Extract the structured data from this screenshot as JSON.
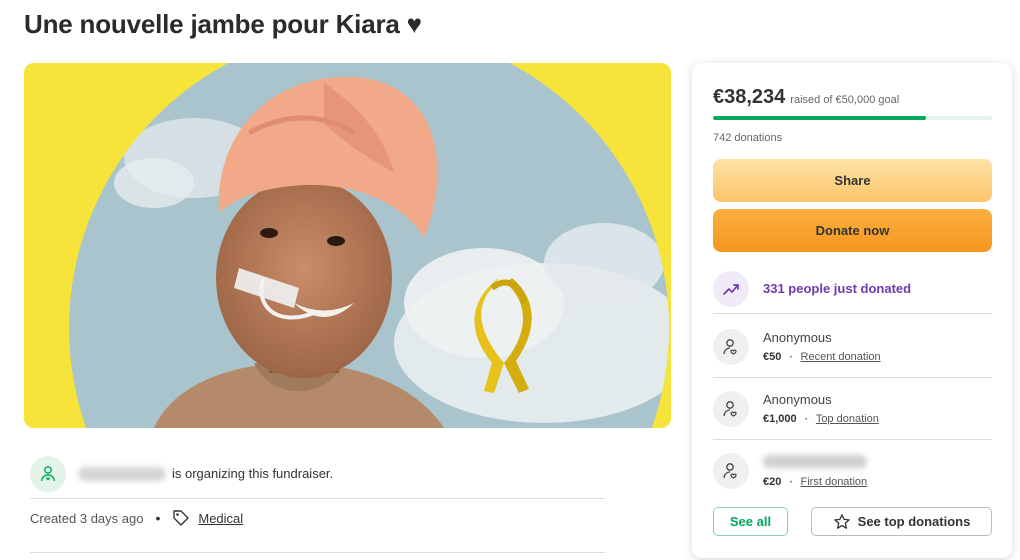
{
  "page": {
    "title": "Une nouvelle jambe pour Kiara ♥"
  },
  "hero": {
    "image_alt": "campaign-photo"
  },
  "organizer": {
    "text": "is organizing this fundraiser.",
    "icon": "person-heart-icon"
  },
  "meta": {
    "created": "Created 3 days ago",
    "separator": "•",
    "category": "Medical",
    "icon": "tag-icon"
  },
  "donation_card": {
    "raised_amount": "€38,234",
    "goal_text": "raised of €50,000 goal",
    "progress_fraction": 0.765,
    "donation_count": "742 donations",
    "share_label": "Share",
    "donate_label": "Donate now",
    "trend_text": "331 people just donated",
    "trend_icon": "trending-up-icon",
    "donors": [
      {
        "name": "Anonymous",
        "amount": "€50",
        "type": "Recent donation"
      },
      {
        "name": "Anonymous",
        "amount": "€1,000",
        "type": "Top donation"
      },
      {
        "name": "",
        "amount": "€20",
        "type": "First donation"
      }
    ],
    "see_all_label": "See all",
    "see_top_label": "See top donations"
  },
  "colors": {
    "accent_green": "#02a95c",
    "donate_orange": "#f5961f",
    "share_peach": "#fbc56a",
    "trend_purple": "#6f3ab0",
    "hero_yellow": "#f6e43a"
  }
}
